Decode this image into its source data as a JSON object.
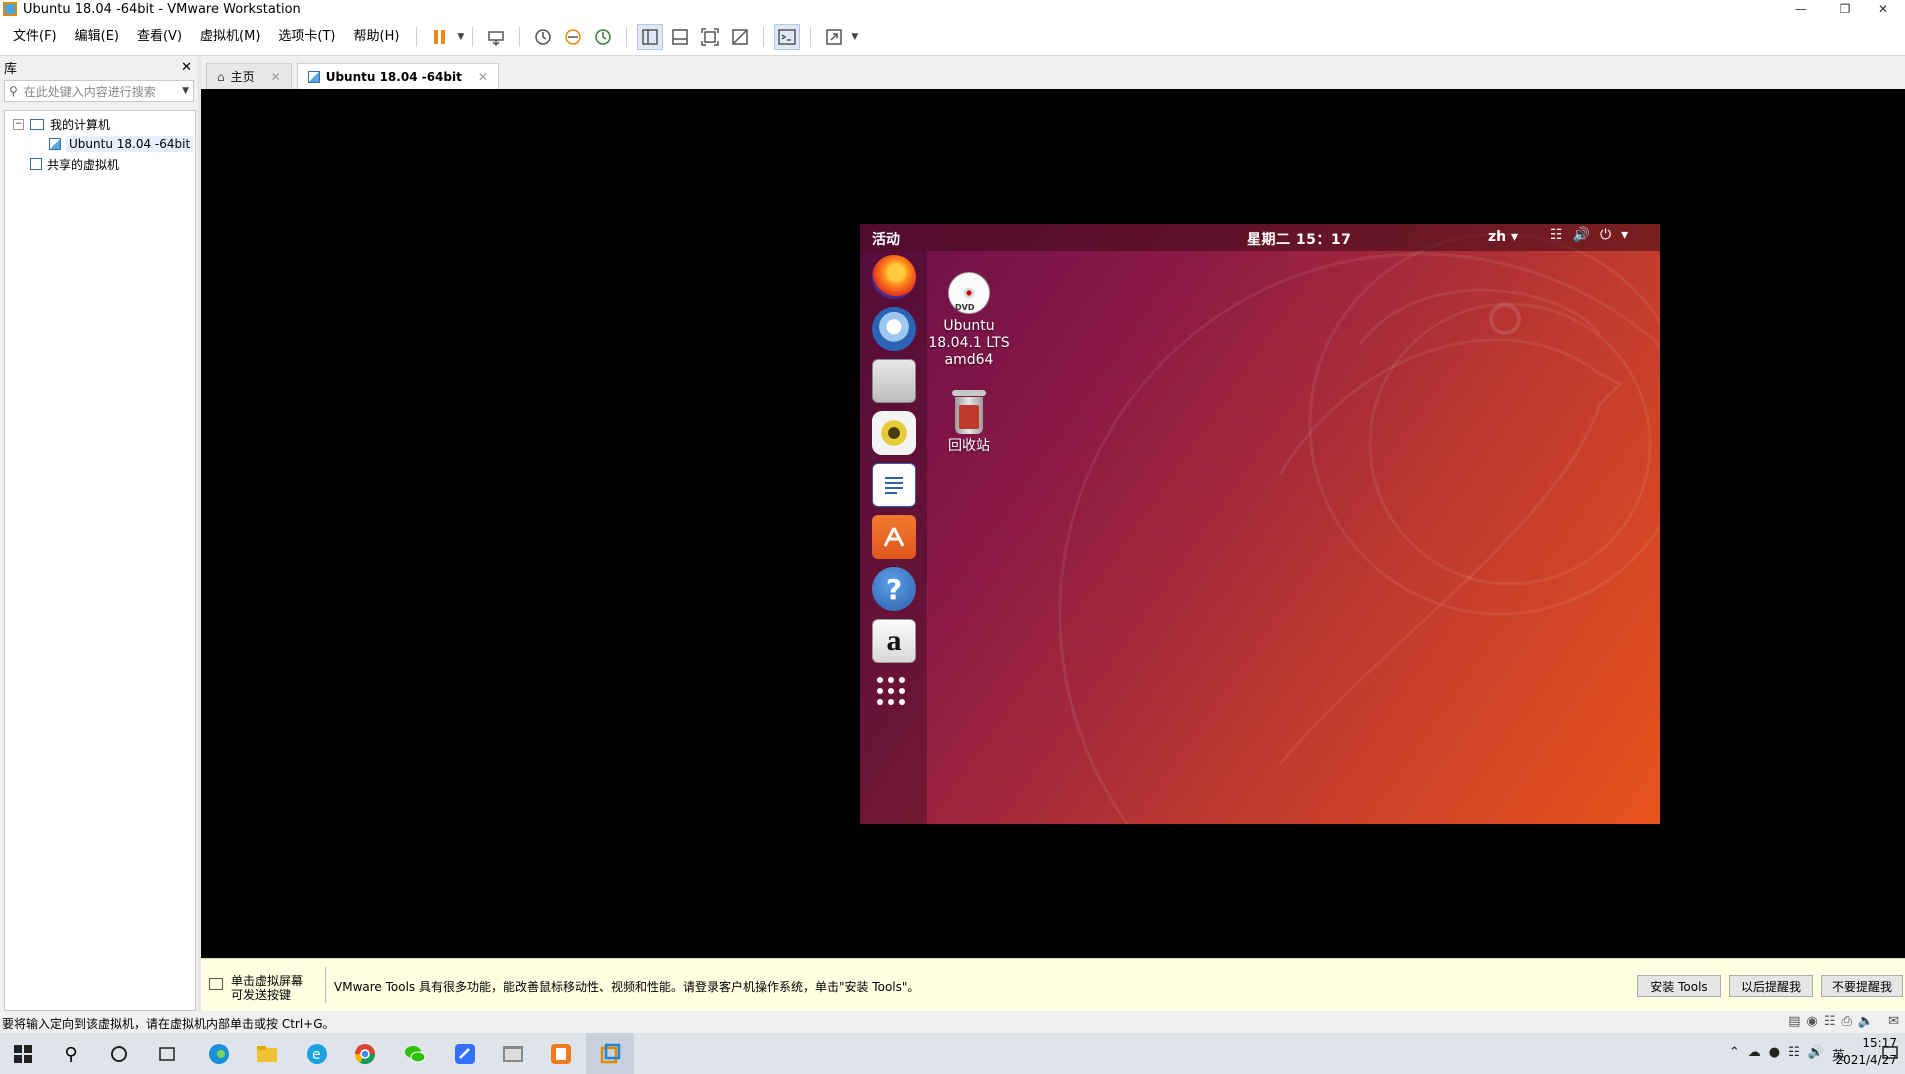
{
  "window": {
    "title": "Ubuntu 18.04 -64bit - VMware Workstation"
  },
  "menu": [
    "文件(F)",
    "编辑(E)",
    "查看(V)",
    "虚拟机(M)",
    "选项卡(T)",
    "帮助(H)"
  ],
  "library": {
    "title": "库",
    "search_placeholder": "在此处键入内容进行搜索",
    "tree": {
      "my_computer": "我的计算机",
      "vm": "Ubuntu 18.04 -64bit",
      "shared": "共享的虚拟机"
    }
  },
  "tabs": [
    {
      "label": "主页",
      "active": false
    },
    {
      "label": "Ubuntu 18.04 -64bit",
      "active": true
    }
  ],
  "guest": {
    "activities": "活动",
    "clock": "星期二 15：17",
    "lang": "zh",
    "desktop_icons": [
      {
        "label": "Ubuntu 18.04.1 LTS amd64",
        "icon": "dvd-icon"
      },
      {
        "label": "回收站",
        "icon": "trash-icon"
      }
    ],
    "dock": [
      "firefox-icon",
      "thunderbird-icon",
      "files-icon",
      "rhythmbox-icon",
      "libreoffice-writer-icon",
      "software-center-icon",
      "help-icon",
      "amazon-icon",
      "show-apps-icon"
    ]
  },
  "notify": {
    "hint": "单击虚拟屏幕\n可发送按键",
    "message": "VMware Tools 具有很多功能，能改善鼠标移动性、视频和性能。请登录客户机操作系统，单击\"安装 Tools\"。",
    "buttons": {
      "install": "安装 Tools",
      "remind": "以后提醒我",
      "never": "不要提醒我"
    }
  },
  "status": {
    "text": "要将输入定向到该虚拟机，请在虚拟机内部单击或按 Ctrl+G。"
  },
  "taskbar": {
    "time": "15:17",
    "date": "2021/4/27",
    "ime": "英"
  },
  "colors": {
    "accent": "#e95420",
    "notify_bg": "#ffffe1"
  }
}
